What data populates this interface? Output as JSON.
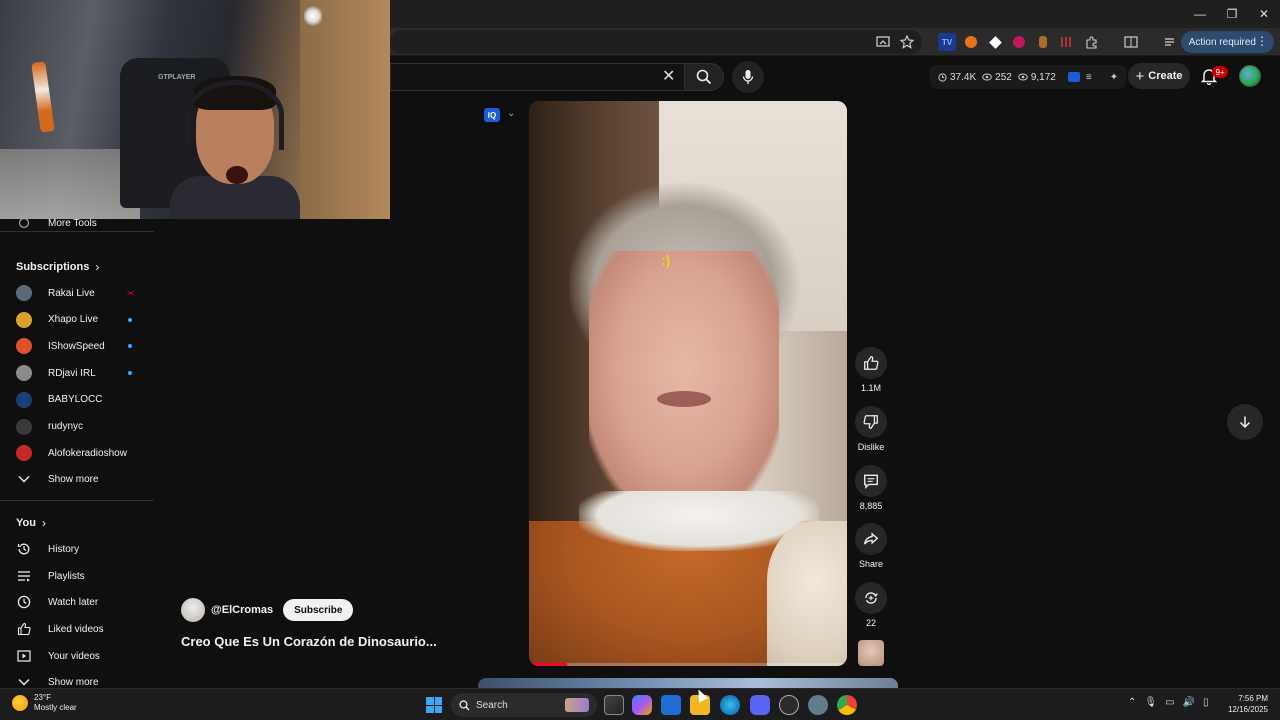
{
  "browser": {
    "action_required": "Action required",
    "minimize": "—",
    "restore": "❐",
    "close": "✕"
  },
  "topbar": {
    "clear": "✕",
    "stats": {
      "views": "37.4K",
      "likes": "252",
      "watching": "9,172"
    },
    "create_label": "Create",
    "notifications_badge": "9+"
  },
  "webcam": {
    "chair_brand": "GTPLAYER"
  },
  "sidebar": {
    "more_tools": "More Tools",
    "subscriptions_heading": "Subscriptions",
    "subscriptions": [
      {
        "name": "Rakai Live",
        "color": "#5b6b7a",
        "status": "live-red"
      },
      {
        "name": "Xhapo Live",
        "color": "#d9a227",
        "status": "new"
      },
      {
        "name": "IShowSpeed",
        "color": "#e0522b",
        "status": "new"
      },
      {
        "name": "RDjavi IRL",
        "color": "#8c8c8c",
        "status": "new"
      },
      {
        "name": "BABYLOCC",
        "color": "#1d3d7a",
        "status": ""
      },
      {
        "name": "rudynyc",
        "color": "#3a3a3a",
        "status": ""
      },
      {
        "name": "Alofokeradioshow",
        "color": "#c62828",
        "status": ""
      }
    ],
    "show_more_1": "Show more",
    "you_heading": "You",
    "you_items": [
      {
        "name": "History"
      },
      {
        "name": "Playlists"
      },
      {
        "name": "Watch later"
      },
      {
        "name": "Liked videos"
      },
      {
        "name": "Your videos"
      }
    ],
    "show_more_2": "Show more"
  },
  "short": {
    "channel": "@ElCromas",
    "subscribe": "Subscribe",
    "title": "Creo Que Es Un Corazón de Dinosaurio...",
    "progress": 0.12,
    "ext_badge": "IQ",
    "cursor": ":)"
  },
  "rail": {
    "likes": "1.1M",
    "dislike": "Dislike",
    "comments": "8,885",
    "share": "Share",
    "remix": "22"
  },
  "taskbar": {
    "temp": "23°F",
    "condition": "Mostly clear",
    "search": "Search",
    "time": "7:56 PM",
    "date": "12/16/2025"
  }
}
